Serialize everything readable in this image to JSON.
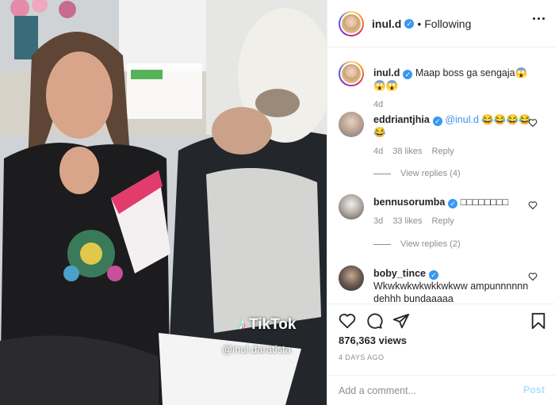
{
  "post": {
    "username": "inul.d",
    "follow_status": "Following",
    "caption_user": "inul.d",
    "caption_text": "Maap boss ga sengaja😱😱😱",
    "caption_age": "4d"
  },
  "comments": [
    {
      "user": "eddriantjhia",
      "text": "@inul.d 😂😂😂😂😂",
      "age": "4d",
      "likes": "38 likes",
      "reply": "Reply",
      "view_replies": "View replies (4)"
    },
    {
      "user": "bennusorumba",
      "text": "□□□□□□□□",
      "age": "3d",
      "likes": "33 likes",
      "reply": "Reply",
      "view_replies": "View replies (2)"
    },
    {
      "user": "boby_tince",
      "text": "Wkwkwkwkwkkwkww ampunnnnnn dehhh bundaaaaa"
    }
  ],
  "stats": {
    "views": "876,363 views",
    "time_ago": "4 DAYS AGO"
  },
  "composer": {
    "placeholder": "Add a comment...",
    "post_label": "Post"
  },
  "video_overlay": {
    "brand": "TikTok",
    "handle": "@inul.daratista"
  },
  "icons": [
    "more-icon",
    "heart-icon",
    "comment-icon",
    "share-icon",
    "bookmark-icon",
    "verified-badge-icon",
    "tiktok-logo-icon"
  ],
  "colors": {
    "verified": "#3897f0",
    "post_button_disabled": "#b2dffc",
    "muted_text": "#8e8e8e"
  }
}
